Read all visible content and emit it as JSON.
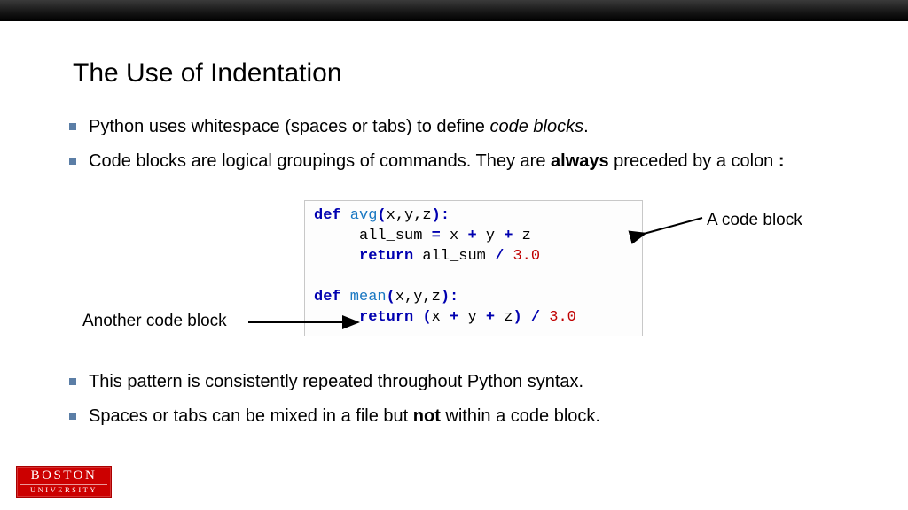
{
  "title": "The Use of Indentation",
  "bullets_top": [
    {
      "pre": "Python uses whitespace (spaces or tabs) to define ",
      "em": "code blocks",
      "post": "."
    },
    {
      "pre": "Code blocks are logical groupings of commands. They are ",
      "strong": "always",
      "post2": " preceded by a colon ",
      "strong2": ":"
    }
  ],
  "bullets_bottom": [
    {
      "text": "This pattern is consistently repeated throughout Python syntax."
    },
    {
      "pre": "Spaces or tabs can be mixed in a file but ",
      "strong": "not",
      "post": " within a code block."
    }
  ],
  "code": {
    "l1": {
      "def": "def",
      "fn": " avg",
      "open": "(",
      "args": "x,y,z",
      "close": "):"
    },
    "l2": {
      "indent": "     all_sum ",
      "eq": "=",
      "a": " x ",
      "p1": "+",
      "b": " y ",
      "p2": "+",
      "c": " z"
    },
    "l3": {
      "indent": "     ",
      "ret": "return",
      "mid": " all_sum ",
      "div": "/",
      "sp": " ",
      "num": "3.0"
    },
    "l4": "",
    "l5": {
      "def": "def",
      "fn": " mean",
      "open": "(",
      "args": "x,y,z",
      "close": "):"
    },
    "l6": {
      "indent": "     ",
      "ret": "return",
      "sp": " ",
      "op": "(",
      "a": "x ",
      "p1": "+",
      "b": " y ",
      "p2": "+",
      "c": " z",
      "cp": ")",
      "sp2": " ",
      "div": "/",
      "sp3": " ",
      "num": "3.0"
    }
  },
  "annotations": {
    "right": "A code block",
    "left": "Another code block"
  },
  "logo": {
    "line1": "BOSTON",
    "line2": "UNIVERSITY"
  }
}
